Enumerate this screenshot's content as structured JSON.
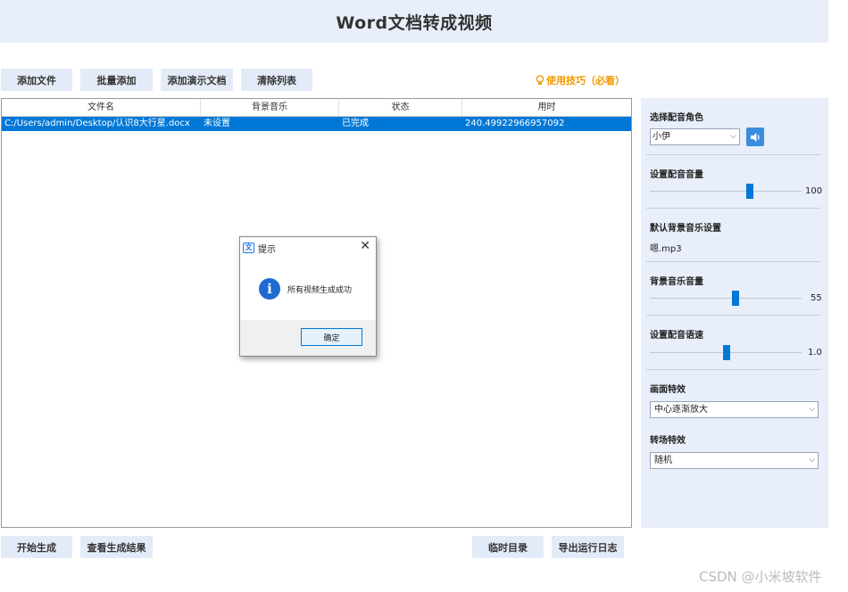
{
  "header": {
    "title": "Word文档转成视频"
  },
  "toolbar": {
    "add_file": "添加文件",
    "batch_add": "批量添加",
    "add_presentation": "添加演示文档",
    "clear_list": "清除列表",
    "tips": "使用技巧（必看）"
  },
  "table": {
    "columns": [
      "文件名",
      "背景音乐",
      "状态",
      "用时"
    ],
    "rows": [
      {
        "file": "C:/Users/admin/Desktop/认识8大行星.docx",
        "music": "未设置",
        "status": "已完成",
        "time": "240.49922966957092"
      }
    ]
  },
  "dialog": {
    "title": "提示",
    "message": "所有视频生成成功",
    "ok_label": "确定"
  },
  "panel": {
    "voice_role_label": "选择配音角色",
    "voice_role_value": "小伊",
    "voice_volume_label": "设置配音音量",
    "voice_volume_value": "100",
    "default_bgm_label": "默认背景音乐设置",
    "default_bgm_value": "嗯.mp3",
    "bgm_volume_label": "背景音乐音量",
    "bgm_volume_value": "55",
    "voice_speed_label": "设置配音语速",
    "voice_speed_value": "1.0",
    "picture_effect_label": "画面特效",
    "picture_effect_value": "中心逐渐放大",
    "transition_label": "转场特效",
    "transition_value": "随机"
  },
  "footer": {
    "start": "开始生成",
    "view_results": "查看生成结果",
    "temp_dir": "临时目录",
    "export_log": "导出运行日志"
  },
  "watermark": "CSDN @小米坡软件",
  "colors": {
    "header_bg": "#e8eefa",
    "selection": "#0078d7",
    "tips": "#f39800",
    "info_icon": "#1e6ad0"
  }
}
